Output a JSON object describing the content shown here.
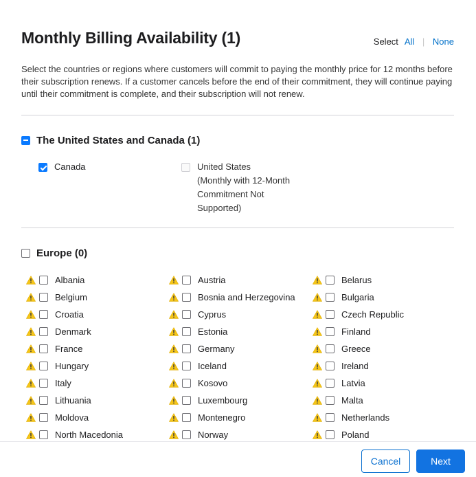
{
  "dialog": {
    "title": "Monthly Billing Availability (1)",
    "select": {
      "label": "Select",
      "all": "All",
      "separator": "|",
      "none": "None"
    },
    "description": "Select the countries or regions where customers will commit to paying the monthly price for 12 months before their subscription renews. If a customer cancels before the end of their commitment, they will continue paying until their commitment is complete, and their subscription will not renew."
  },
  "groups": {
    "us_canada": {
      "title": "The United States and Canada (1)",
      "state": "mixed",
      "items": [
        {
          "label": "Canada",
          "checked": true,
          "disabled": false
        },
        {
          "label": "United States\n(Monthly with 12-Month Commitment Not Supported)",
          "checked": false,
          "disabled": true
        }
      ]
    },
    "europe": {
      "title": "Europe (0)",
      "state": "unchecked",
      "countries": [
        [
          "Albania",
          "Austria",
          "Belarus"
        ],
        [
          "Belgium",
          "Bosnia and Herzegovina",
          "Bulgaria"
        ],
        [
          "Croatia",
          "Cyprus",
          "Czech Republic"
        ],
        [
          "Denmark",
          "Estonia",
          "Finland"
        ],
        [
          "France",
          "Germany",
          "Greece"
        ],
        [
          "Hungary",
          "Iceland",
          "Ireland"
        ],
        [
          "Italy",
          "Kosovo",
          "Latvia"
        ],
        [
          "Lithuania",
          "Luxembourg",
          "Malta"
        ],
        [
          "Moldova",
          "Montenegro",
          "Netherlands"
        ],
        [
          "North Macedonia",
          "Norway",
          "Poland"
        ]
      ]
    }
  },
  "footer": {
    "cancel_label": "Cancel",
    "next_label": "Next"
  },
  "colors": {
    "accent": "#0a7aff",
    "warning": "#f5c518",
    "button_primary": "#1273e1"
  },
  "icons": {
    "warning": "warning-triangle-icon"
  }
}
